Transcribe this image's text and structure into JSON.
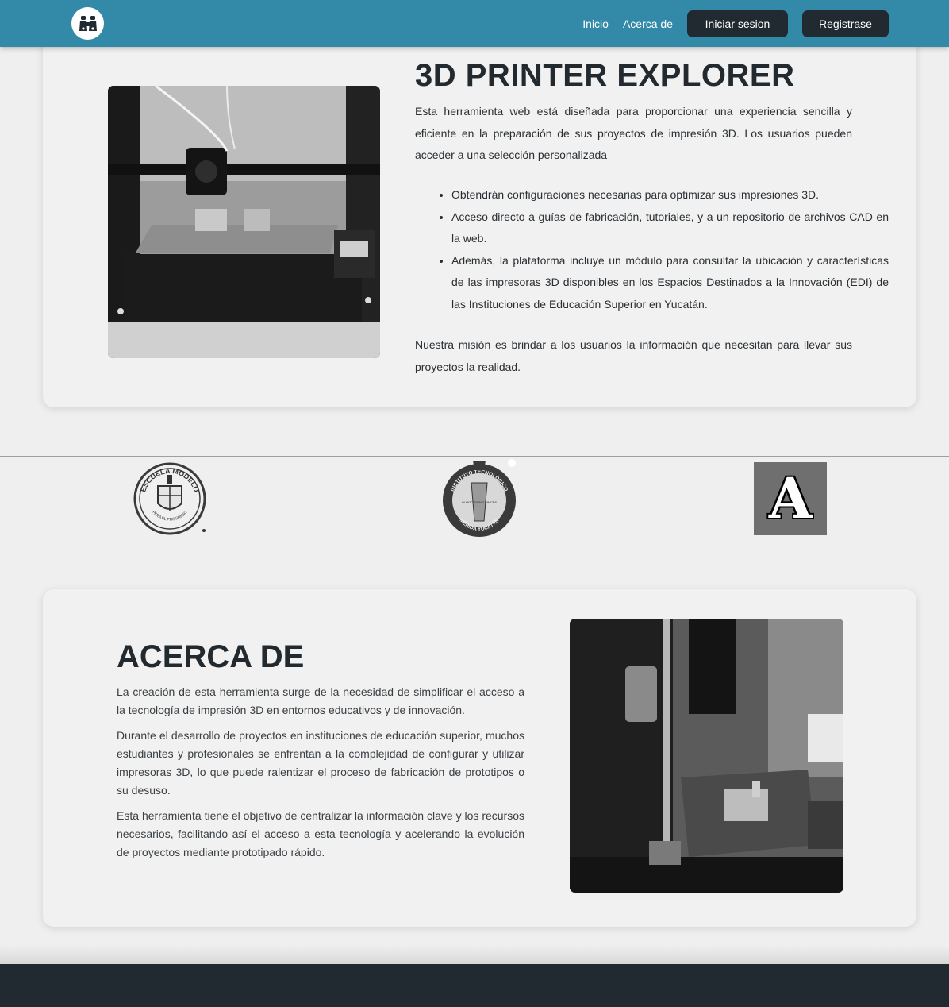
{
  "nav": {
    "logo_icon": "binoculars-icon",
    "links": [
      "Inicio",
      "Acerca de"
    ],
    "login_label": "Iniciar sesion",
    "register_label": "Registrase"
  },
  "hero": {
    "title": "3D PRINTER EXPLORER",
    "intro": "Esta herramienta web está diseñada para proporcionar una experiencia sencilla y eficiente en la preparación de sus proyectos de impresión 3D. Los usuarios pueden acceder a una selección personalizada",
    "bullets": [
      "Obtendrán configuraciones necesarias para optimizar sus impresiones 3D.",
      "Acceso directo a guías de fabricación, tutoriales, y a un repositorio de archivos CAD en la web.",
      "Además, la plataforma incluye un módulo para consultar la ubicación y características de las impresoras 3D disponibles en los Espacios Destinados a la Innovación (EDI) de las Instituciones de Educación Superior en Yucatán."
    ],
    "mission": "Nuestra misión es brindar a los usuarios la información que necesitan para llevar sus proyectos la realidad."
  },
  "logos": {
    "escuela_modelo": {
      "text_top": "ESCUELA MODELO",
      "text_bottom": "PARA EL PROGRESO"
    },
    "instituto": {
      "text_top": "INSTITUTO TECNOLÓGICO",
      "text_bottom": "MÉRIDA YUCATÁN",
      "center": "IN HOC SIGNO VINCES"
    },
    "anahuac": {
      "letter": "A"
    }
  },
  "about": {
    "title": "ACERCA DE",
    "paragraphs": [
      "La creación de esta herramienta surge de la necesidad de simplificar el acceso a la tecnología de impresión 3D en entornos educativos y de innovación.",
      "Durante el desarrollo de proyectos en instituciones de educación superior, muchos estudiantes y profesionales se enfrentan a la complejidad de configurar y utilizar impresoras 3D, lo que puede ralentizar el proceso de fabricación de prototipos o su desuso.",
      "Esta herramienta tiene el objetivo de centralizar la información clave y los recursos necesarios, facilitando así el acceso a esta tecnología y acelerando la evolución de proyectos mediante prototipado rápido."
    ]
  }
}
